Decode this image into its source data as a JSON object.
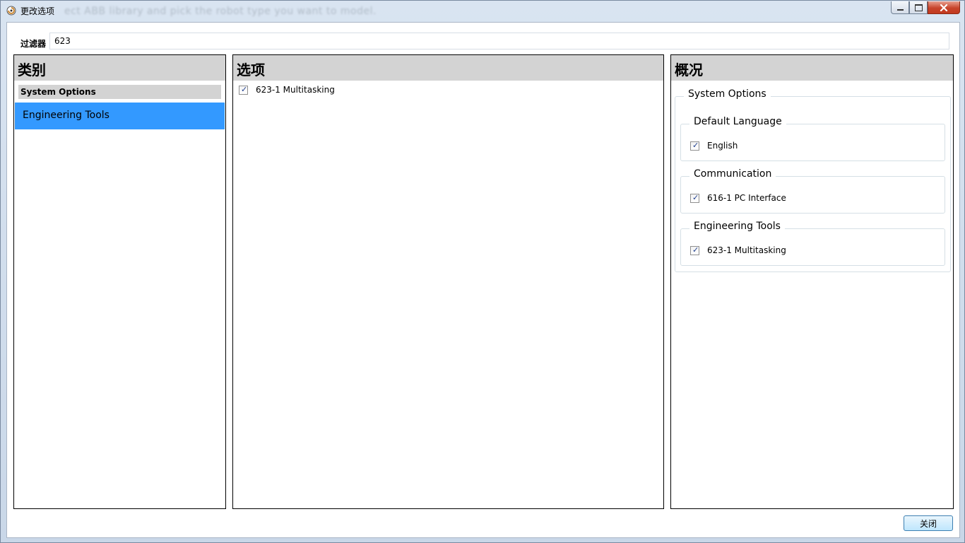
{
  "window": {
    "title": "更改选项",
    "background_text": "ect ABB library and pick the robot type you want to model."
  },
  "filter": {
    "label": "过滤器",
    "value": "623"
  },
  "categories": {
    "header": "类别",
    "group": "System Options",
    "selected_item": "Engineering Tools",
    "selected_color": "#3399ff"
  },
  "options": {
    "header": "选项",
    "items": [
      {
        "label": "623-1 Multitasking",
        "checked": true
      }
    ]
  },
  "summary": {
    "header": "概况",
    "group_title": "System Options",
    "sections": [
      {
        "title": "Default Language",
        "item": "English",
        "checked": true
      },
      {
        "title": "Communication",
        "item": "616-1 PC Interface",
        "checked": true
      },
      {
        "title": "Engineering Tools",
        "item": "623-1 Multitasking",
        "checked": true
      }
    ]
  },
  "footer": {
    "close_label": "关闭"
  }
}
